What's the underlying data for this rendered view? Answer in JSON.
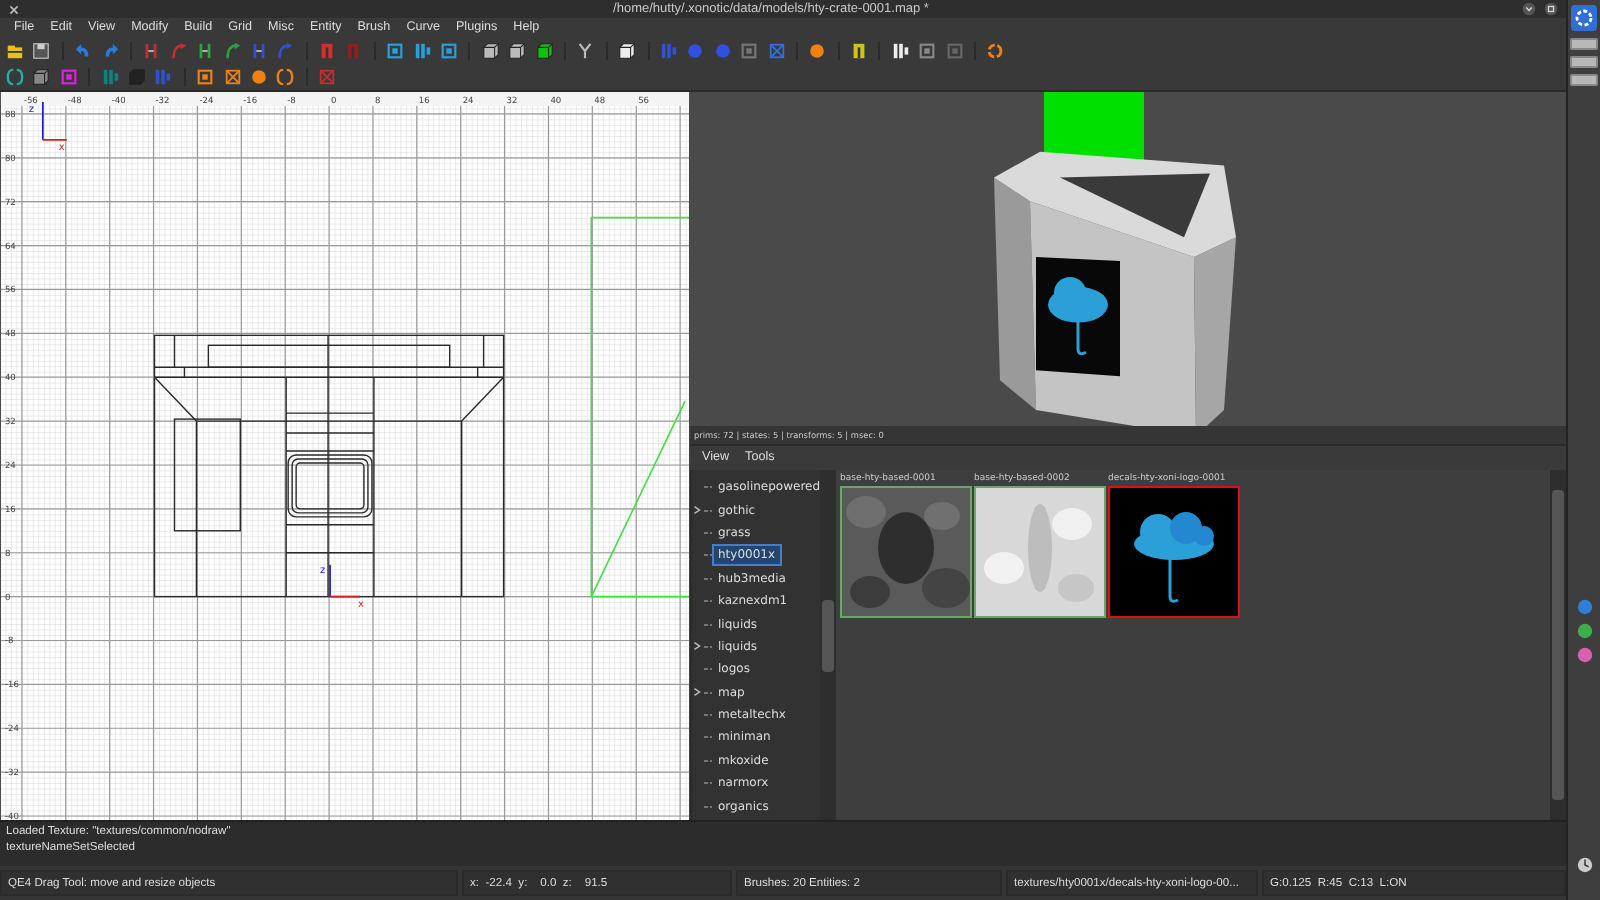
{
  "window": {
    "title": "/home/hutty/.xonotic/data/models/hty-crate-0001.map *"
  },
  "menu": [
    "File",
    "Edit",
    "View",
    "Modify",
    "Build",
    "Grid",
    "Misc",
    "Entity",
    "Brush",
    "Curve",
    "Plugins",
    "Help"
  ],
  "view_2d": {
    "x_ticks": [
      "-56",
      "-48",
      "-40",
      "-32",
      "-24",
      "-16",
      "-8",
      "0",
      "8",
      "16",
      "24",
      "32",
      "40",
      "48",
      "56"
    ],
    "z_ticks": [
      "88",
      "80",
      "72",
      "64",
      "56",
      "48",
      "40",
      "32",
      "24",
      "16",
      "8",
      "0",
      "-8",
      "-16",
      "-24",
      "-32",
      "-40"
    ],
    "corner_axes": [
      "z",
      "x"
    ],
    "origin_axes": [
      "z",
      "x"
    ]
  },
  "view_3d": {
    "stats": "prims: 72 | states: 5 | transforms: 5 | msec: 0"
  },
  "texture_browser": {
    "menu": [
      "View",
      "Tools"
    ],
    "folders": [
      {
        "label": "gasolinepowered",
        "expandable": false,
        "selected": false
      },
      {
        "label": "gothic",
        "expandable": true,
        "selected": false
      },
      {
        "label": "grass",
        "expandable": false,
        "selected": false
      },
      {
        "label": "hty0001x",
        "expandable": false,
        "selected": true
      },
      {
        "label": "hub3media",
        "expandable": false,
        "selected": false
      },
      {
        "label": "kaznexdm1",
        "expandable": false,
        "selected": false
      },
      {
        "label": "liquids",
        "expandable": false,
        "selected": false
      },
      {
        "label": "liquids",
        "expandable": true,
        "selected": false
      },
      {
        "label": "logos",
        "expandable": false,
        "selected": false
      },
      {
        "label": "map",
        "expandable": true,
        "selected": false
      },
      {
        "label": "metaltechx",
        "expandable": false,
        "selected": false
      },
      {
        "label": "miniman",
        "expandable": false,
        "selected": false
      },
      {
        "label": "mkoxide",
        "expandable": false,
        "selected": false
      },
      {
        "label": "narmorx",
        "expandable": false,
        "selected": false
      },
      {
        "label": "organics",
        "expandable": false,
        "selected": false
      }
    ],
    "textures": [
      {
        "name": "base-hty-based-0001",
        "kind": "dark",
        "selected": false
      },
      {
        "name": "base-hty-based-0002",
        "kind": "light",
        "selected": false
      },
      {
        "name": "decals-hty-xoni-logo-0001",
        "kind": "logo",
        "selected": true
      }
    ]
  },
  "console": [
    "Loaded Texture: \"textures/common/nodraw\"",
    "textureNameSetSelected"
  ],
  "status_bar": [
    "QE4 Drag Tool: move and resize objects",
    "x:  -22.4  y:    0.0  z:    91.5",
    "Brushes: 20 Entities: 2",
    "textures/hty0001x/decals-hty-xoni-logo-00...",
    "G:0.125  R:45  C:13  L:ON"
  ]
}
